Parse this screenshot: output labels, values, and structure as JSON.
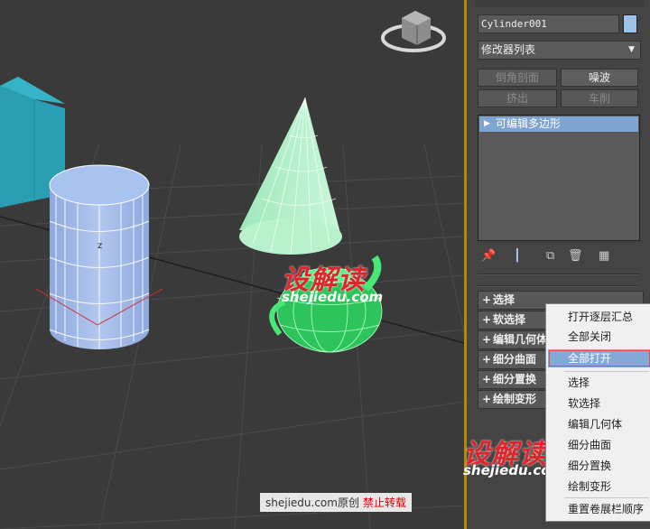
{
  "viewport": {
    "label_z": "z",
    "watermark_main": "设解读",
    "watermark_sub": "shejiedu.com",
    "credit": {
      "text": "shejiedu.com原创",
      "warning": "禁止转载"
    },
    "colors": {
      "box": "#2aa0b4",
      "cylinder": "#9fb8e8",
      "cone": "#a9f0c4",
      "teapot": "#47e874",
      "grid": "#555555",
      "background": "#3a3a3a"
    }
  },
  "panel": {
    "object_name": "Cylinder001",
    "modifier_list": "修改器列表",
    "buttons": {
      "bevel_profile": "倒角剖面",
      "noise": "噪波",
      "extrude": "挤出",
      "lathe": "车削"
    },
    "stack_item": "可编辑多边形",
    "rollouts": [
      "选择",
      "软选择",
      "编辑几何体",
      "细分曲面",
      "细分置换",
      "绘制变形"
    ]
  },
  "context_menu": {
    "items": [
      "打开逐层汇总",
      "全部关闭",
      "全部打开",
      "选择",
      "软选择",
      "编辑几何体",
      "细分曲面",
      "细分置换",
      "绘制变形",
      "重置卷展栏顺序"
    ],
    "highlighted": "全部打开"
  }
}
